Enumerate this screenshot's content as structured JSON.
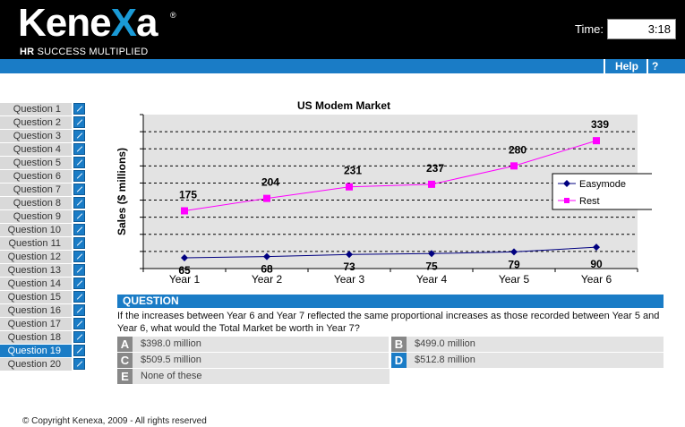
{
  "header": {
    "logo_text_a": "Kene",
    "logo_text_x": "X",
    "logo_text_b": "a",
    "logo_reg": "®",
    "tagline_bold": "HR",
    "tagline_rest": "SUCCESS MULTIPLIED",
    "time_label": "Time:",
    "time_value": "3:18"
  },
  "nav": {
    "help": "Help",
    "question_mark": "?"
  },
  "sidebar": {
    "items": [
      {
        "label": "Question 1"
      },
      {
        "label": "Question 2"
      },
      {
        "label": "Question 3"
      },
      {
        "label": "Question 4"
      },
      {
        "label": "Question 5"
      },
      {
        "label": "Question 6"
      },
      {
        "label": "Question 7"
      },
      {
        "label": "Question 8"
      },
      {
        "label": "Question 9"
      },
      {
        "label": "Question 10"
      },
      {
        "label": "Question 11"
      },
      {
        "label": "Question 12"
      },
      {
        "label": "Question 13"
      },
      {
        "label": "Question 14"
      },
      {
        "label": "Question 15"
      },
      {
        "label": "Question 16"
      },
      {
        "label": "Question 17"
      },
      {
        "label": "Question 18"
      },
      {
        "label": "Question 19",
        "active": true
      },
      {
        "label": "Question 20"
      }
    ]
  },
  "chart_data": {
    "type": "line",
    "title": "US Modem Market",
    "ylabel": "Sales ($ millions)",
    "xlabel": "",
    "categories": [
      "Year 1",
      "Year 2",
      "Year 3",
      "Year 4",
      "Year 5",
      "Year 6"
    ],
    "series": [
      {
        "name": "Easymode",
        "values": [
          65,
          68,
          73,
          75,
          79,
          90
        ],
        "color": "#000080",
        "marker": "diamond"
      },
      {
        "name": "Rest",
        "values": [
          175,
          204,
          231,
          237,
          280,
          339
        ],
        "color": "#ff00ff",
        "marker": "square"
      }
    ],
    "ylim": [
      40,
      400
    ],
    "grid": true,
    "legend_position": "right"
  },
  "question": {
    "header": "QUESTION",
    "text": "If the increases between Year 6 and Year 7 reflected the same proportional increases as those recorded between Year 5 and Year 6, what would the Total Market be worth in Year 7?"
  },
  "answers": [
    {
      "letter": "A",
      "text": "$398.0 million",
      "highlight": false
    },
    {
      "letter": "B",
      "text": "$499.0 million",
      "highlight": false
    },
    {
      "letter": "C",
      "text": "$509.5 million",
      "highlight": false
    },
    {
      "letter": "D",
      "text": "$512.8 million",
      "highlight": true
    },
    {
      "letter": "E",
      "text": "None of these",
      "highlight": false
    }
  ],
  "footer": {
    "copyright": "© Copyright Kenexa, 2009 - All rights reserved"
  }
}
